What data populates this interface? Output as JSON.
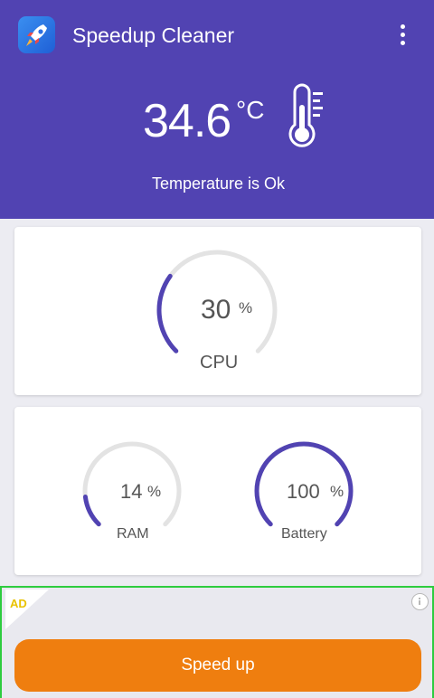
{
  "app": {
    "title": "Speedup Cleaner",
    "icon": "rocket-icon",
    "menu_icon": "more-vert-icon"
  },
  "temperature": {
    "value": "34.6",
    "unit": "°C",
    "status": "Temperature is Ok",
    "icon": "thermometer-icon"
  },
  "gauges": {
    "cpu": {
      "value": "30",
      "unit": "%",
      "label": "CPU",
      "fraction": 0.3
    },
    "ram": {
      "value": "14",
      "unit": "%",
      "label": "RAM",
      "fraction": 0.14
    },
    "battery": {
      "value": "100",
      "unit": "%",
      "label": "Battery",
      "fraction": 1.0
    }
  },
  "ad": {
    "badge": "AD",
    "info_icon": "info-icon"
  },
  "action": {
    "speed_label": "Speed up"
  },
  "colors": {
    "header": "#5143b2",
    "gauge_fill": "#5143b2",
    "gauge_track": "#e3e3e3",
    "button": "#ef7e0f",
    "ad_border": "#2ecc3f",
    "ad_badge": "#e9c200"
  }
}
